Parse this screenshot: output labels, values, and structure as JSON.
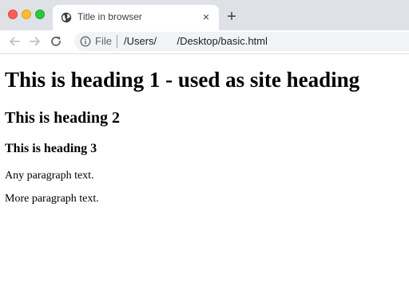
{
  "tab": {
    "title": "Title in browser",
    "favicon": "globe-icon",
    "close": "×"
  },
  "new_tab": "+",
  "toolbar": {
    "back": "arrow-left-icon",
    "forward": "arrow-right-icon",
    "reload": "reload-icon",
    "omnibox": {
      "info_icon": "info-icon",
      "scheme": "File",
      "url": "/Users/       /Desktop/basic.html"
    }
  },
  "page": {
    "h1": "This is heading 1 - used as site heading",
    "h2": "This is heading 2",
    "h3": "This is heading 3",
    "p1": "Any paragraph text.",
    "p2": "More paragraph text."
  },
  "colors": {
    "titlebar": "#dee1e6",
    "close": "#fd5f57",
    "minimize": "#fdbc2e",
    "maximize": "#28c840",
    "omnibox": "#f1f3f4"
  }
}
